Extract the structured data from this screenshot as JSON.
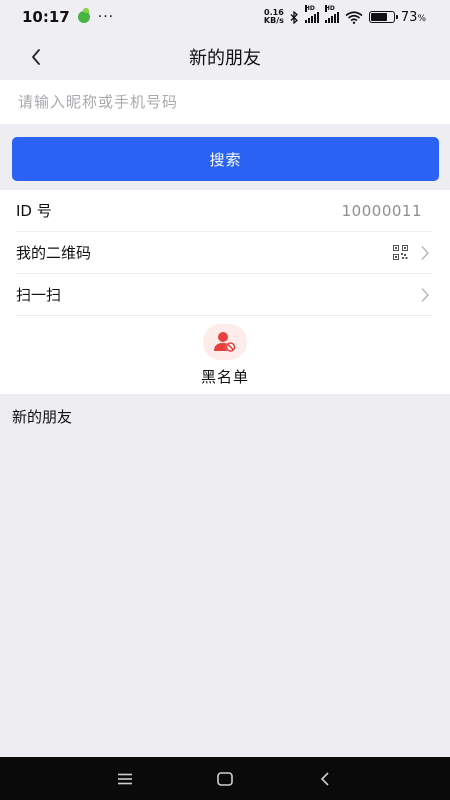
{
  "status_bar": {
    "time": "10:17",
    "more": "···",
    "net_speed_top": "0.16",
    "net_speed_bottom": "KB/s",
    "battery_pct": "73",
    "battery_pct_suffix": "%",
    "hd_label": "HD"
  },
  "header": {
    "title": "新的朋友",
    "back_icon": "chevron-left-icon"
  },
  "search": {
    "placeholder": "请输入昵称或手机号码",
    "value": "",
    "button_label": "搜索"
  },
  "list": {
    "id_label": "ID 号",
    "id_value": "10000011",
    "qrcode_label": "我的二维码",
    "scan_label": "扫一扫"
  },
  "blacklist": {
    "label": "黑名单",
    "icon": "user-block-icon",
    "icon_color": "#e8403c"
  },
  "section": {
    "title": "新的朋友"
  },
  "colors": {
    "accent": "#2a63f4",
    "background": "#eeeef2"
  }
}
